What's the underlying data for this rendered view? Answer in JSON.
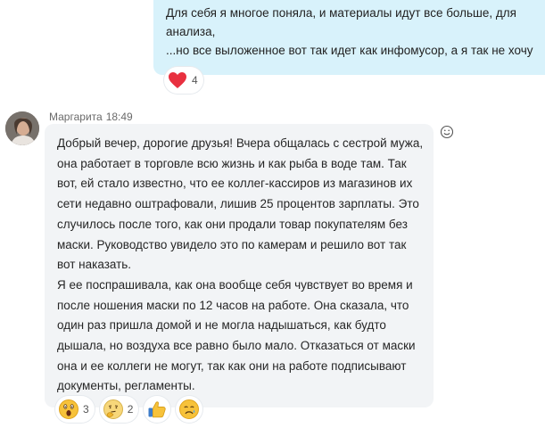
{
  "own_message": {
    "lines": [
      "Для себя я многое поняла, и материалы идут все больше, для",
      "анализа,",
      "...но все выложенное вот так идет как инфомусор, а я так не хочу"
    ],
    "reactions": [
      {
        "icon": "heart-icon",
        "count": "4"
      }
    ]
  },
  "incoming_message": {
    "sender": "Маргарита",
    "time": "18:49",
    "lines": [
      "Добрый вечер, дорогие друзья! Вчера общалась с сестрой мужа,",
      "она работает в торговле всю жизнь и как рыба в воде там. Так",
      "вот, ей стало известно, что ее коллег-кассиров из магазинов их",
      "сети недавно оштрафовали, лишив 25 процентов зарплаты. Это",
      "случилось после того, как они продали товар покупателям без",
      "маски. Руководство увидело это по камерам и решило вот так",
      "вот наказать.",
      "Я ее поспрашивала, как она вообще себя чувствует во время и",
      "после ношения маски по 12 часов на работе. Она сказала, что",
      "один раз пришла домой и не могла надышаться, как будто",
      "дышала, но воздуха все равно было мало. Отказаться от маски",
      "она и ее коллеги не могут, так как они на работе подписывают",
      "документы, регламенты."
    ],
    "reactions": [
      {
        "icon": "surprised-face-icon",
        "count": "3"
      },
      {
        "icon": "thinking-face-icon",
        "count": "2"
      },
      {
        "icon": "thumbs-up-icon",
        "count": ""
      },
      {
        "icon": "sad-face-icon",
        "count": ""
      }
    ]
  },
  "colors": {
    "own_bubble": "#d8f2fb",
    "incoming_bubble": "#f2f4f6",
    "heart": "#e8303f",
    "emoji_yellow": "#f7c23a"
  }
}
